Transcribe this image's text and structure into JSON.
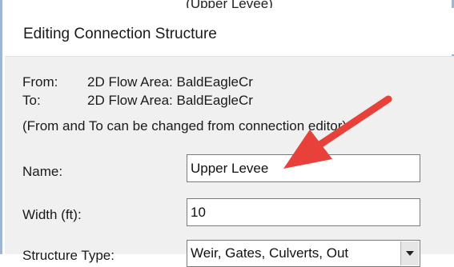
{
  "top_caption": "(Upper Levee)",
  "dialog": {
    "title": "Editing Connection Structure",
    "from_label": "From:",
    "from_value": "2D Flow Area: BaldEagleCr",
    "to_label": "To:",
    "to_value": "2D Flow Area: BaldEagleCr",
    "note": "(From and To can be changed from connection editor)",
    "name_label": "Name:",
    "name_value": "Upper Levee",
    "width_label": "Width (ft):",
    "width_value": "10",
    "structure_type_label": "Structure Type:",
    "structure_type_value": "Weir, Gates, Culverts, Out"
  },
  "annotation": {
    "arrow_color": "#e8413a"
  }
}
